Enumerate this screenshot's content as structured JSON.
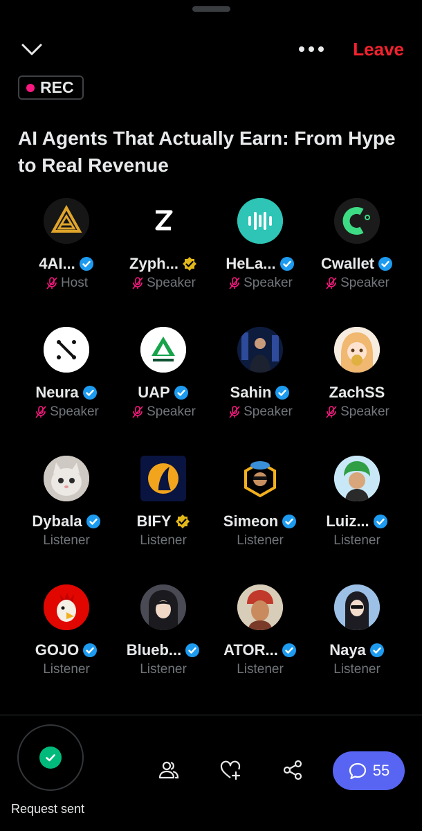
{
  "header": {
    "leave_label": "Leave",
    "rec_label": "REC"
  },
  "space": {
    "title": "AI Agents That Actually Earn: From Hype to Real Revenue"
  },
  "participants": [
    {
      "name": "4AI...",
      "role": "Host",
      "verified": "blue",
      "muted": true
    },
    {
      "name": "Zyph...",
      "role": "Speaker",
      "verified": "gold",
      "muted": true
    },
    {
      "name": "HeLa...",
      "role": "Speaker",
      "verified": "blue",
      "muted": true
    },
    {
      "name": "Cwallet",
      "role": "Speaker",
      "verified": "blue",
      "muted": true
    },
    {
      "name": "Neura",
      "role": "Speaker",
      "verified": "blue",
      "muted": true
    },
    {
      "name": "UAP",
      "role": "Speaker",
      "verified": "blue",
      "muted": true
    },
    {
      "name": "Sahin",
      "role": "Speaker",
      "verified": "blue",
      "muted": true
    },
    {
      "name": "ZachSS",
      "role": "Speaker",
      "verified": "none",
      "muted": true
    },
    {
      "name": "Dybala",
      "role": "Listener",
      "verified": "blue",
      "muted": false
    },
    {
      "name": "BIFY",
      "role": "Listener",
      "verified": "gold",
      "muted": false
    },
    {
      "name": "Simeon",
      "role": "Listener",
      "verified": "blue",
      "muted": false
    },
    {
      "name": "Luiz...",
      "role": "Listener",
      "verified": "blue",
      "muted": false
    },
    {
      "name": "GOJO",
      "role": "Listener",
      "verified": "blue",
      "muted": false
    },
    {
      "name": "Blueb...",
      "role": "Listener",
      "verified": "blue",
      "muted": false
    },
    {
      "name": "ATOR...",
      "role": "Listener",
      "verified": "blue",
      "muted": false
    },
    {
      "name": "Naya",
      "role": "Listener",
      "verified": "blue",
      "muted": false
    }
  ],
  "footer": {
    "request_label": "Request sent",
    "comments_count": "55"
  },
  "colors": {
    "accent": "#5865f2",
    "leave": "#f4212e",
    "verified_blue": "#1d9bf0",
    "verified_gold": "#e2b719",
    "muted_mic": "#f91880",
    "success": "#00ba7c"
  }
}
